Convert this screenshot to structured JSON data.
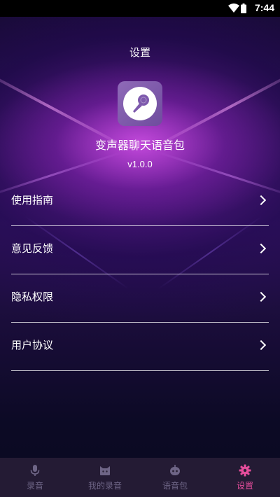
{
  "status_bar": {
    "time": "7:44"
  },
  "header": {
    "title": "设置"
  },
  "app_info": {
    "name": "变声器聊天语音包",
    "version": "v1.0.0"
  },
  "menu": {
    "items": [
      {
        "label": "使用指南"
      },
      {
        "label": "意见反馈"
      },
      {
        "label": "隐私权限"
      },
      {
        "label": "用户协议"
      }
    ]
  },
  "tabs": [
    {
      "label": "录音",
      "icon": "microphone-icon"
    },
    {
      "label": "我的录音",
      "icon": "cat-icon"
    },
    {
      "label": "语音包",
      "icon": "robot-icon"
    },
    {
      "label": "设置",
      "icon": "gear-icon",
      "active": true
    }
  ],
  "colors": {
    "accent": "#e64d9c",
    "inactive": "#6e6586",
    "logo": "#7e5aad"
  }
}
